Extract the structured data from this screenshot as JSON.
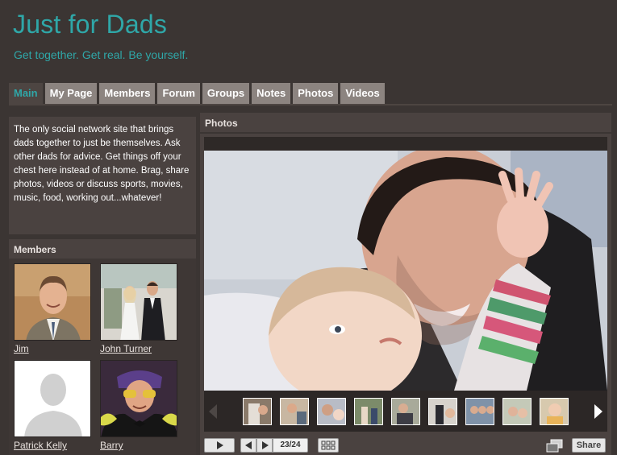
{
  "site": {
    "title": "Just for Dads",
    "tagline": "Get together. Get real. Be yourself."
  },
  "tabs": [
    {
      "label": "Main",
      "active": true
    },
    {
      "label": "My Page"
    },
    {
      "label": "Members"
    },
    {
      "label": "Forum"
    },
    {
      "label": "Groups"
    },
    {
      "label": "Notes"
    },
    {
      "label": "Photos"
    },
    {
      "label": "Videos"
    }
  ],
  "intro": {
    "text": "The only social network site that brings dads together to just be themselves. Ask other dads for advice. Get things off your chest here instead of at home. Brag, share photos, videos or discuss sports, movies, music, food, working out...whatever!"
  },
  "members": {
    "heading": "Members",
    "items": [
      {
        "name": "Jim"
      },
      {
        "name": "John Turner"
      },
      {
        "name": "Patrick Kelly"
      },
      {
        "name": "Barry"
      }
    ]
  },
  "photos": {
    "heading": "Photos",
    "counter": "23/24",
    "share_label": "Share",
    "thumb_count": 9
  },
  "colors": {
    "accent": "#2fa7a8",
    "background": "#3b3533",
    "tab": "#8c8480"
  }
}
